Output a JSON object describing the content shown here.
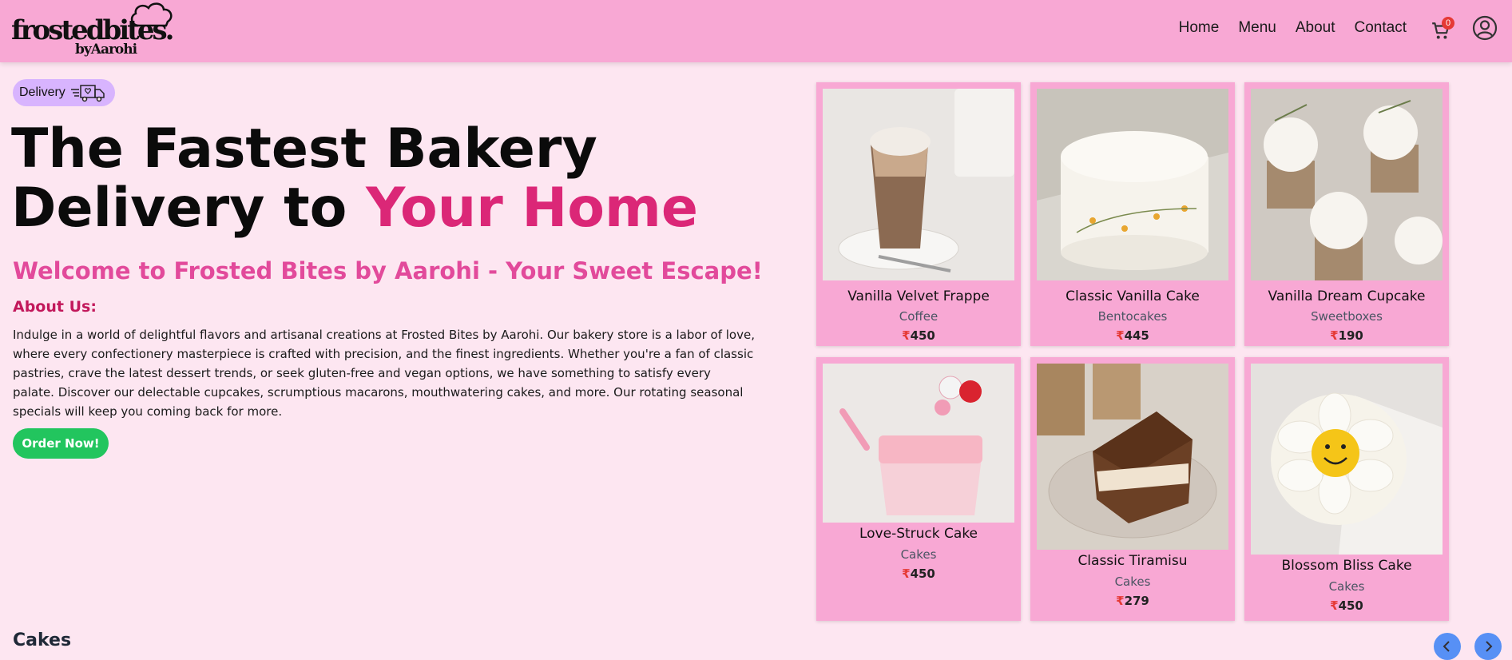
{
  "header": {
    "logo": {
      "main": "frostedbites.",
      "sub": "byAarohi"
    },
    "nav": [
      "Home",
      "Menu",
      "About",
      "Contact"
    ],
    "cart_count": "0"
  },
  "hero": {
    "delivery_label": "Delivery",
    "title_line1": "The Fastest Bakery",
    "title_line2_plain": "Delivery to ",
    "title_line2_accent": "Your Home",
    "subtitle": "Welcome to Frosted Bites by Aarohi - Your Sweet Escape!",
    "about_heading": "About Us:",
    "about_text": "Indulge in a world of delightful flavors and artisanal creations at Frosted Bites by Aarohi. Our bakery store is a labor of love, where every confectionery masterpiece is crafted with precision, and the finest ingredients. Whether you're a fan of classic pastries, crave the latest dessert trends, or seek gluten-free and vegan options, we have something to satisfy every palate. Discover our delectable cupcakes, scrumptious macarons, mouthwatering cakes, and more. Our rotating seasonal specials will keep you coming back for more.",
    "order_button": "Order Now!"
  },
  "products": [
    {
      "name": "Vanilla Velvet Frappe",
      "category": "Coffee",
      "currency": "₹",
      "price": "450"
    },
    {
      "name": "Classic Vanilla Cake",
      "category": "Bentocakes",
      "currency": "₹",
      "price": "445"
    },
    {
      "name": "Vanilla Dream Cupcake",
      "category": "Sweetboxes",
      "currency": "₹",
      "price": "190"
    },
    {
      "name": "Love-Struck Cake",
      "category": "Cakes",
      "currency": "₹",
      "price": "450"
    },
    {
      "name": "Classic Tiramisu",
      "category": "Cakes",
      "currency": "₹",
      "price": "279"
    },
    {
      "name": "Blossom Bliss Cake",
      "category": "Cakes",
      "currency": "₹",
      "price": "450"
    }
  ],
  "section": {
    "title": "Cakes"
  },
  "colors": {
    "header": "#f8a8d4",
    "page": "#fde6f1",
    "accent": "#db2777",
    "cta": "#22c55e",
    "arrow": "#3b82f6"
  }
}
